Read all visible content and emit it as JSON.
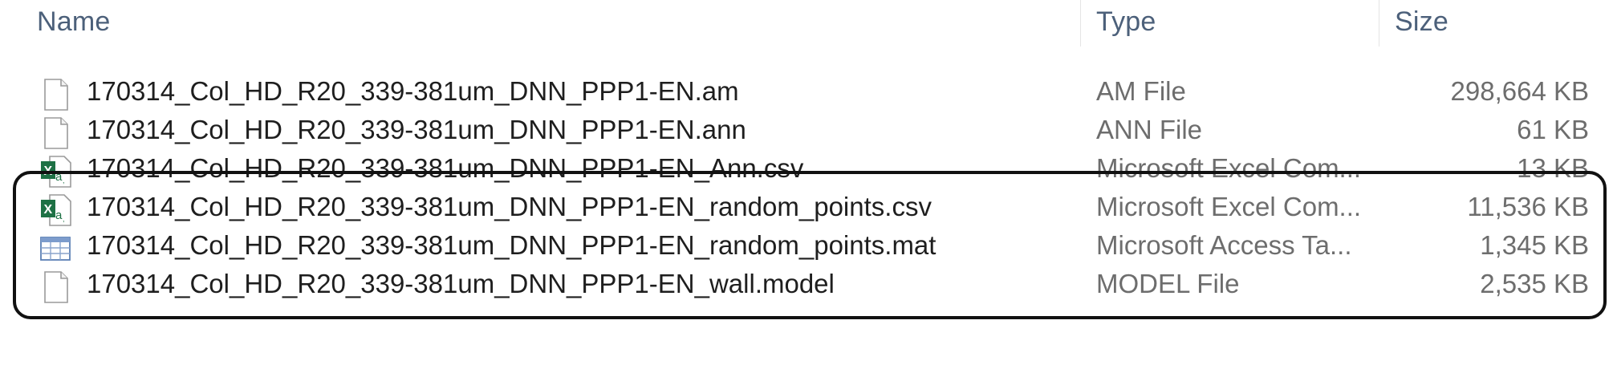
{
  "columns": {
    "name": "Name",
    "type": "Type",
    "size": "Size"
  },
  "files": [
    {
      "name": "170314_Col_HD_R20_339-381um_DNN_PPP1-EN.am",
      "type": "AM File",
      "size": "298,664 KB",
      "icon": "generic-file-icon"
    },
    {
      "name": "170314_Col_HD_R20_339-381um_DNN_PPP1-EN.ann",
      "type": "ANN File",
      "size": "61 KB",
      "icon": "generic-file-icon"
    },
    {
      "name": "170314_Col_HD_R20_339-381um_DNN_PPP1-EN_Ann.csv",
      "type": "Microsoft Excel Com...",
      "size": "13 KB",
      "icon": "excel-csv-icon"
    },
    {
      "name": "170314_Col_HD_R20_339-381um_DNN_PPP1-EN_random_points.csv",
      "type": "Microsoft Excel Com...",
      "size": "11,536 KB",
      "icon": "excel-csv-icon"
    },
    {
      "name": "170314_Col_HD_R20_339-381um_DNN_PPP1-EN_random_points.mat",
      "type": "Microsoft Access Ta...",
      "size": "1,345 KB",
      "icon": "access-table-icon"
    },
    {
      "name": "170314_Col_HD_R20_339-381um_DNN_PPP1-EN_wall.model",
      "type": "MODEL File",
      "size": "2,535 KB",
      "icon": "generic-file-icon"
    }
  ],
  "colors": {
    "header_text": "#4c607a",
    "secondary_text": "#6d6d6d",
    "excel_green": "#1e7145",
    "highlight_border": "#111111"
  }
}
